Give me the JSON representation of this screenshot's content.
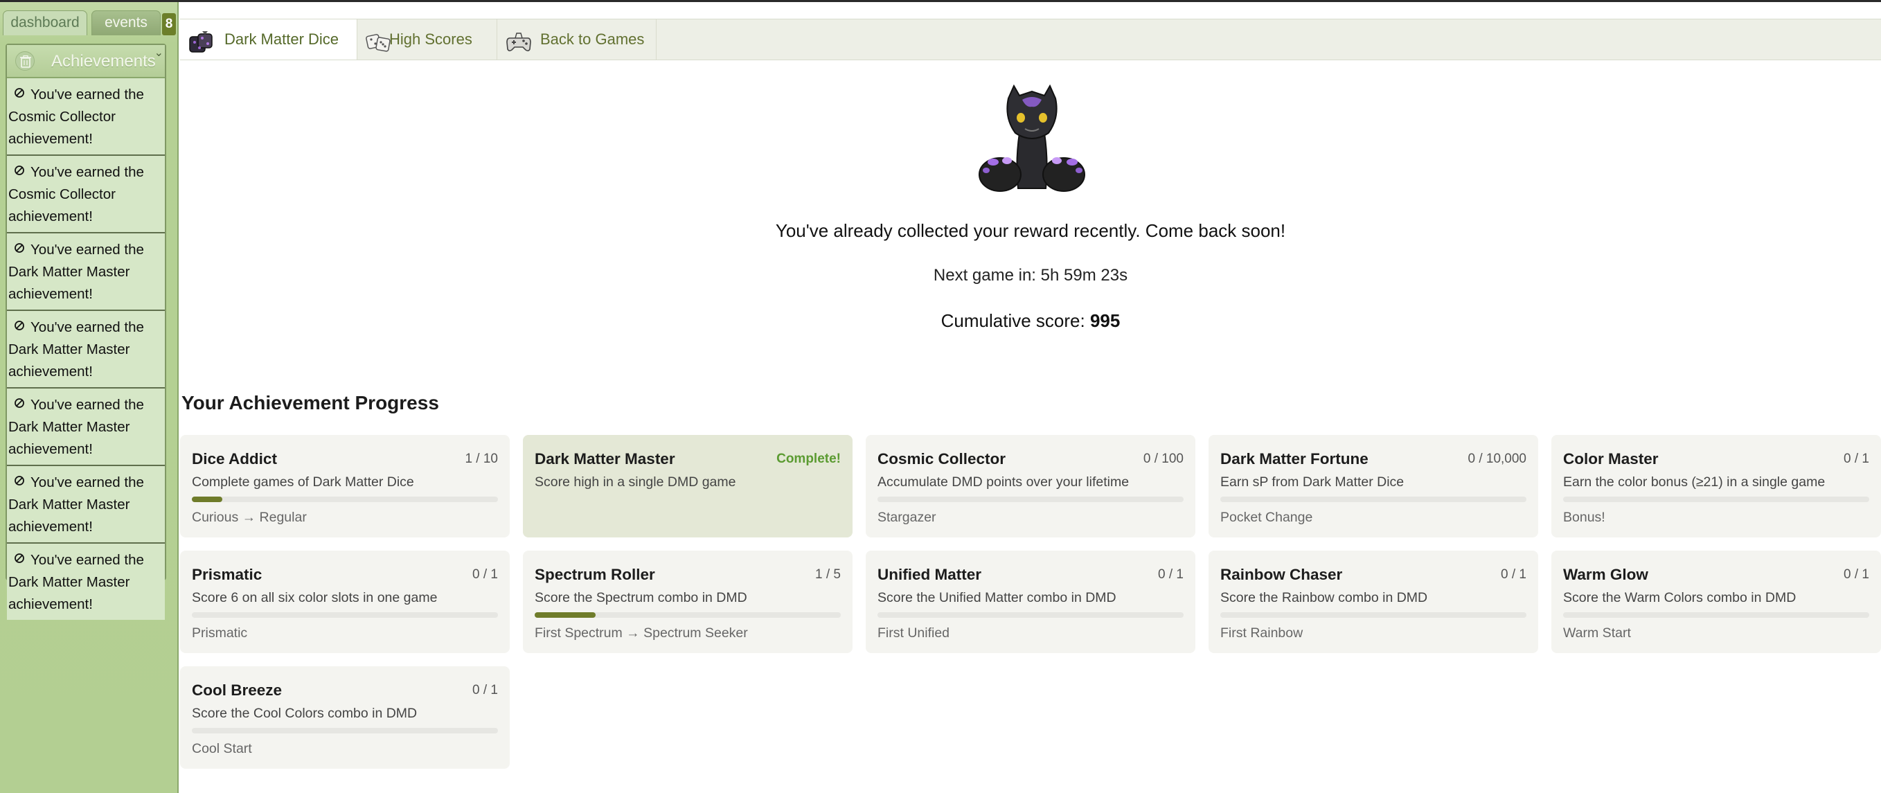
{
  "sidebar": {
    "tabs": [
      {
        "label": "dashboard"
      },
      {
        "label": "events",
        "badge": "8"
      }
    ],
    "achievements_panel": {
      "title": "Achievements",
      "notifications": [
        {
          "text": "You've earned the Cosmic Collector achievement!"
        },
        {
          "text": "You've earned the Cosmic Collector achievement!"
        },
        {
          "text": "You've earned the Dark Matter Master achievement!"
        },
        {
          "text": "You've earned the Dark Matter Master achievement!"
        },
        {
          "text": "You've earned the Dark Matter Master achievement!"
        },
        {
          "text": "You've earned the Dark Matter Master achievement!"
        },
        {
          "text": "You've earned the Dark Matter Master achievement!"
        }
      ]
    }
  },
  "nav": {
    "tabs": [
      {
        "label": "Dark Matter Dice",
        "icon": "dice-creature-icon",
        "active": true
      },
      {
        "label": "High Scores",
        "icon": "dice-pair-icon",
        "active": false
      },
      {
        "label": "Back to Games",
        "icon": "game-controller-icon",
        "active": false
      }
    ]
  },
  "main": {
    "reward_message": "You've already collected your reward recently. Come back soon!",
    "next_game_label": "Next game in:",
    "next_game_time": "5h 59m 23s",
    "cumulative_label": "Cumulative score:",
    "cumulative_value": "995",
    "progress_title": "Your Achievement Progress",
    "achievements": [
      {
        "name": "Dice Addict",
        "count": "1 / 10",
        "desc": "Complete games of Dark Matter Dice",
        "tier": "Curious → Regular",
        "progress": 0.1,
        "complete": false
      },
      {
        "name": "Dark Matter Master",
        "count": "Complete!",
        "desc": "Score high in a single DMD game",
        "tier": "",
        "progress": 1,
        "complete": true
      },
      {
        "name": "Cosmic Collector",
        "count": "0 / 100",
        "desc": "Accumulate DMD points over your lifetime",
        "tier": "Stargazer",
        "progress": 0,
        "complete": false
      },
      {
        "name": "Dark Matter Fortune",
        "count": "0 / 10,000",
        "desc": "Earn sP from Dark Matter Dice",
        "tier": "Pocket Change",
        "progress": 0,
        "complete": false
      },
      {
        "name": "Color Master",
        "count": "0 / 1",
        "desc": "Earn the color bonus (≥21) in a single game",
        "tier": "Bonus!",
        "progress": 0,
        "complete": false
      },
      {
        "name": "Prismatic",
        "count": "0 / 1",
        "desc": "Score 6 on all six color slots in one game",
        "tier": "Prismatic",
        "progress": 0,
        "complete": false
      },
      {
        "name": "Spectrum Roller",
        "count": "1 / 5",
        "desc": "Score the Spectrum combo in DMD",
        "tier": "First Spectrum → Spectrum Seeker",
        "progress": 0.2,
        "complete": false
      },
      {
        "name": "Unified Matter",
        "count": "0 / 1",
        "desc": "Score the Unified Matter combo in DMD",
        "tier": "First Unified",
        "progress": 0,
        "complete": false
      },
      {
        "name": "Rainbow Chaser",
        "count": "0 / 1",
        "desc": "Score the Rainbow combo in DMD",
        "tier": "First Rainbow",
        "progress": 0,
        "complete": false
      },
      {
        "name": "Warm Glow",
        "count": "0 / 1",
        "desc": "Score the Warm Colors combo in DMD",
        "tier": "Warm Start",
        "progress": 0,
        "complete": false
      },
      {
        "name": "Cool Breeze",
        "count": "0 / 1",
        "desc": "Score the Cool Colors combo in DMD",
        "tier": "Cool Start",
        "progress": 0,
        "complete": false
      }
    ]
  },
  "colors": {
    "sidebar_green": "#b5d094",
    "accent_olive": "#6f7c2a",
    "complete_green": "#5b9b31"
  }
}
